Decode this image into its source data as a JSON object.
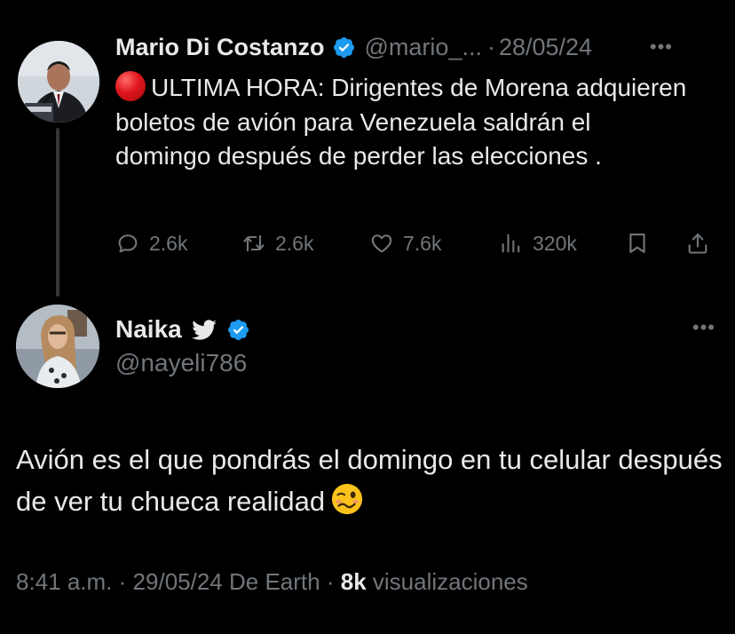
{
  "parent_tweet": {
    "display_name": "Mario Di Costanzo",
    "handle": "@mario_...",
    "separator": "·",
    "date": "28/05/24",
    "text": "ULTIMA HORA: Dirigentes de Morena adquieren boletos de avión para Venezuela saldrán el domingo después de perder las elecciones .",
    "leading_icon": "red-circle-emoji",
    "actions": {
      "replies": "2.6k",
      "retweets": "2.6k",
      "likes": "7.6k",
      "views": "320k"
    }
  },
  "reply_tweet": {
    "display_name": "Naika",
    "name_icon": "bird-icon",
    "handle": "@nayeli786",
    "text": "Avión es el que pondrás el domingo en tu celular después de ver tu chueca realidad",
    "trailing_icon": "woozy-face-emoji",
    "time": "8:41 a.m.",
    "separator1": "·",
    "date": "29/05/24",
    "source": "De Earth",
    "separator2": "·",
    "views_count": "8k",
    "views_label": "visualizaciones"
  },
  "colors": {
    "background": "#000000",
    "text": "#e7e9ea",
    "muted": "#71767b",
    "verified": "#1d9bf0"
  }
}
